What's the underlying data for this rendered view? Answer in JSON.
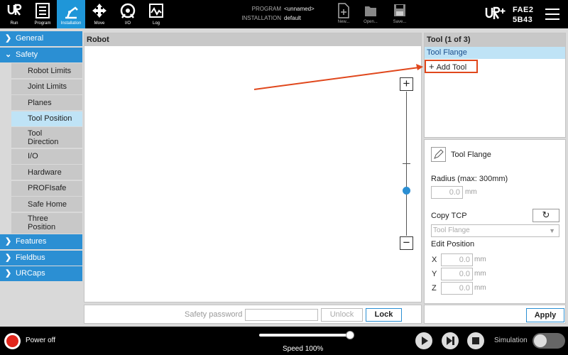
{
  "topbar": {
    "nav": [
      {
        "label": "Run",
        "icon": "ur-logo-icon"
      },
      {
        "label": "Program",
        "icon": "program-icon"
      },
      {
        "label": "Installation",
        "icon": "installation-icon",
        "active": true
      },
      {
        "label": "Move",
        "icon": "move-icon"
      },
      {
        "label": "I/O",
        "icon": "io-icon"
      },
      {
        "label": "Log",
        "icon": "log-icon"
      }
    ],
    "program_key": "PROGRAM",
    "program_value": "<unnamed>",
    "installation_key": "INSTALLATION",
    "installation_value": "default",
    "file_buttons": [
      {
        "label": "New...",
        "icon": "new-file-icon"
      },
      {
        "label": "Open...",
        "icon": "open-folder-icon"
      },
      {
        "label": "Save...",
        "icon": "save-icon"
      }
    ],
    "robot_name_line1": "FAE2",
    "robot_name_line2": "5B43"
  },
  "sidebar": {
    "sections": [
      {
        "label": "General",
        "expanded": false
      },
      {
        "label": "Safety",
        "expanded": true,
        "items": [
          "Robot Limits",
          "Joint Limits",
          "Planes",
          "Tool Position",
          "Tool Direction",
          "I/O",
          "Hardware",
          "PROFIsafe",
          "Safe Home",
          "Three Position"
        ],
        "active_item": "Tool Position"
      },
      {
        "label": "Features",
        "expanded": false
      },
      {
        "label": "Fieldbus",
        "expanded": false
      },
      {
        "label": "URCaps",
        "expanded": false
      }
    ]
  },
  "robot_panel": {
    "title": "Robot"
  },
  "tool_panel": {
    "title": "Tool (1 of 3)",
    "selected_tool": "Tool Flange",
    "add_tool_label": "Add Tool"
  },
  "config_panel": {
    "tool_name": "Tool Flange",
    "radius_label": "Radius (max: 300mm)",
    "radius_value": "0.0",
    "radius_unit": "mm",
    "copy_tcp_label": "Copy TCP",
    "tcp_select_value": "Tool Flange",
    "edit_position_label": "Edit Position",
    "positions": [
      {
        "axis": "X",
        "value": "0.0",
        "unit": "mm"
      },
      {
        "axis": "Y",
        "value": "0.0",
        "unit": "mm"
      },
      {
        "axis": "Z",
        "value": "0.0",
        "unit": "mm"
      }
    ]
  },
  "password_bar": {
    "label": "Safety password",
    "unlock_label": "Unlock",
    "lock_label": "Lock",
    "apply_label": "Apply"
  },
  "footer": {
    "power_label": "Power off",
    "speed_label": "Speed 100%",
    "speed_fraction": 1.0,
    "simulation_label": "Simulation"
  },
  "colors": {
    "accent": "#2b8fd3",
    "active_tab": "#1f96d8",
    "selected_row": "#bfe3f6",
    "annotation": "#e0471c",
    "power": "#e1261c"
  }
}
